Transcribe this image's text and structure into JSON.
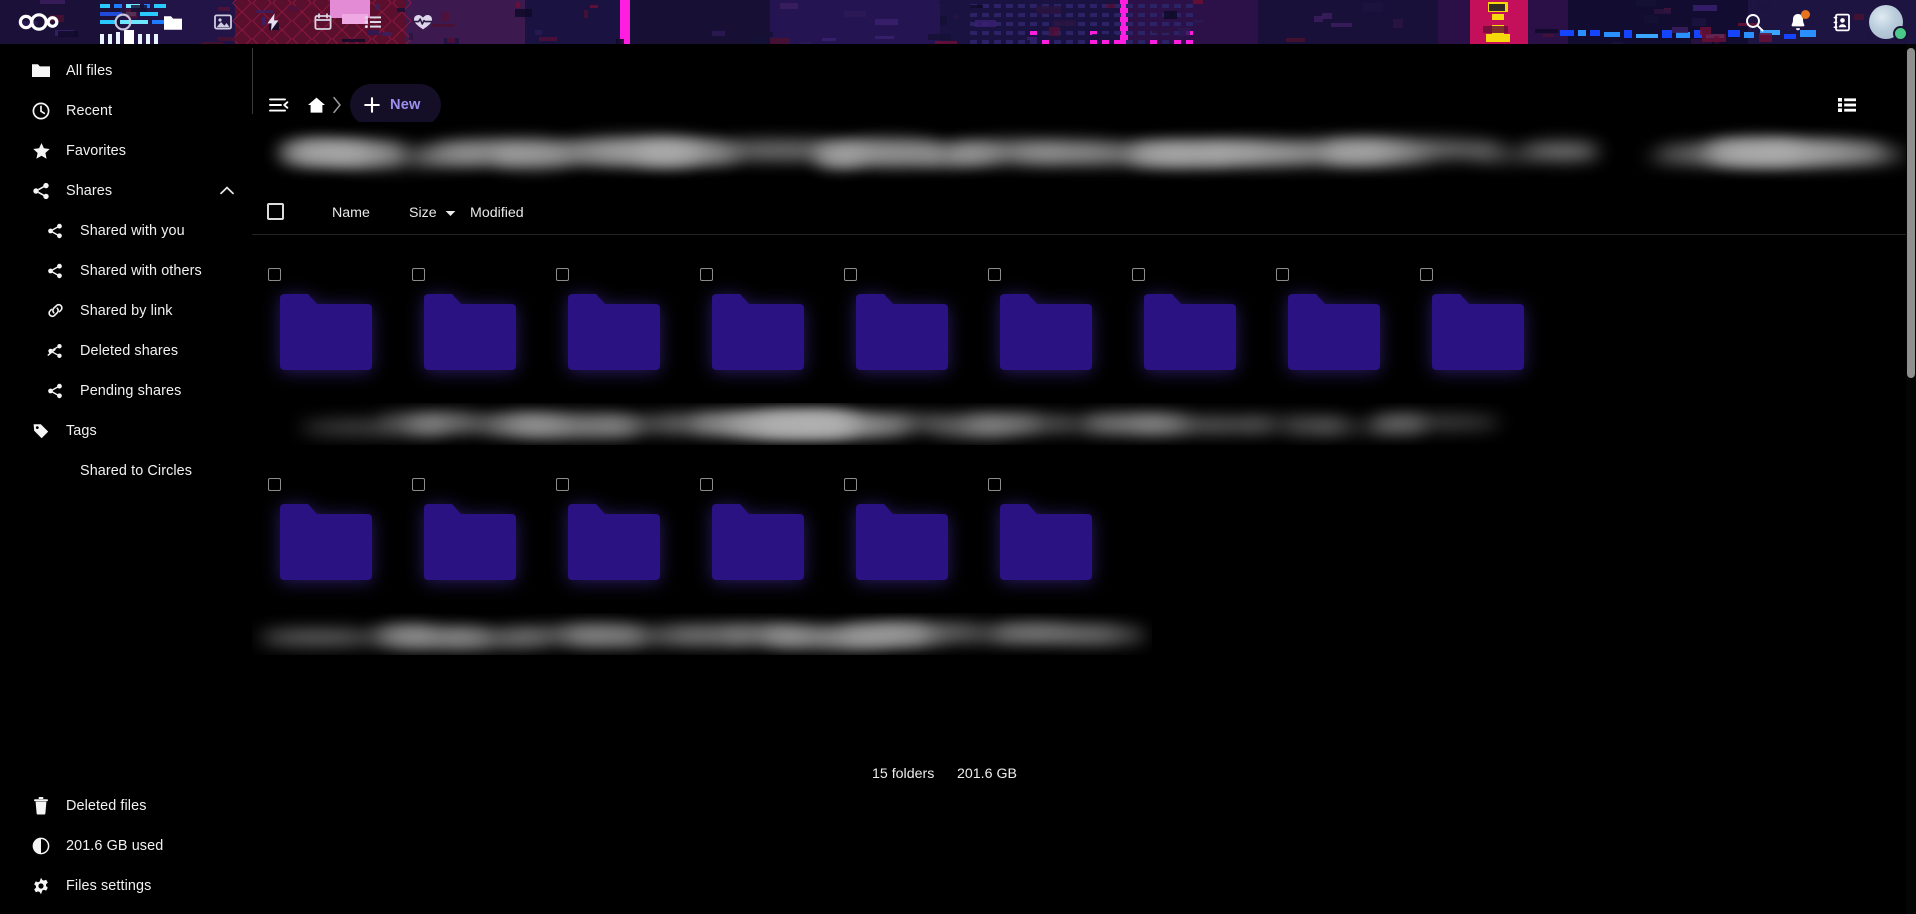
{
  "header": {
    "logo_name": "nextcloud-logo",
    "background_color": "#1b1235",
    "accent_magenta": "#ff1ee0",
    "app_icons": [
      {
        "name": "dashboard-icon",
        "label": "Dashboard",
        "active": false
      },
      {
        "name": "files-icon",
        "label": "Files",
        "active": true
      },
      {
        "name": "photos-icon",
        "label": "Photos",
        "active": false
      },
      {
        "name": "activity-icon",
        "label": "Activity",
        "active": false
      },
      {
        "name": "calendar-icon",
        "label": "Calendar",
        "active": false
      },
      {
        "name": "tasks-icon",
        "label": "Tasks",
        "active": false
      },
      {
        "name": "health-icon",
        "label": "Health",
        "active": false
      }
    ],
    "right_actions": [
      {
        "name": "search-icon",
        "label": "Search"
      },
      {
        "name": "notifications-bell-icon",
        "label": "Notifications",
        "badge": true,
        "badge_color": "#e8731d"
      },
      {
        "name": "contacts-icon",
        "label": "Contacts"
      }
    ],
    "avatar": {
      "label": "User avatar",
      "status": "online",
      "status_color": "#4ac98b"
    }
  },
  "sidebar": {
    "background_color": "#000000",
    "items": [
      {
        "label": "All files",
        "icon": "folder-icon",
        "level": 0,
        "active": false
      },
      {
        "label": "Recent",
        "icon": "clock-icon",
        "level": 0,
        "active": false
      },
      {
        "label": "Favorites",
        "icon": "star-icon",
        "level": 0,
        "active": false
      },
      {
        "label": "Shares",
        "icon": "share-icon",
        "level": 0,
        "active": false,
        "expanded": true,
        "collapse_icon": "chevron-up-icon"
      },
      {
        "label": "Shared with you",
        "icon": "share-icon",
        "level": 1,
        "active": false
      },
      {
        "label": "Shared with others",
        "icon": "share-icon",
        "level": 1,
        "active": false
      },
      {
        "label": "Shared by link",
        "icon": "link-icon",
        "level": 1,
        "active": false
      },
      {
        "label": "Deleted shares",
        "icon": "share-off-icon",
        "level": 1,
        "active": false
      },
      {
        "label": "Pending shares",
        "icon": "share-icon",
        "level": 1,
        "active": false
      },
      {
        "label": "Tags",
        "icon": "tag-icon",
        "level": 0,
        "active": false
      },
      {
        "label": "Shared to Circles",
        "icon": "circles-icon",
        "level": 1,
        "active": false,
        "no_icon": true
      }
    ],
    "bottom_items": [
      {
        "label": "Deleted files",
        "icon": "trash-icon"
      },
      {
        "label": "201.6 GB used",
        "icon": "pie-chart-icon"
      },
      {
        "label": "Files settings",
        "icon": "gear-icon"
      }
    ]
  },
  "toolbar": {
    "sidebar_toggle_icon": "sidebar-collapse-icon",
    "home_icon": "home-icon",
    "breadcrumb_separator_icon": "chevron-right-icon",
    "new_label": "New",
    "new_plus_icon": "plus-icon",
    "new_text_color": "#9d8ff0",
    "view_toggle_icon": "list-view-icon"
  },
  "file_table": {
    "select_all_label": "",
    "columns": [
      {
        "label": "Name",
        "sortable": true
      },
      {
        "label": "Size",
        "sortable": true,
        "sorted": true,
        "sort_icon": "caret-down-icon"
      },
      {
        "label": "Modified",
        "sortable": true
      }
    ],
    "folder_color": "#2b1283",
    "rows": [
      {
        "tiles": 9,
        "redacted_names": true
      },
      {
        "tiles": 6,
        "redacted_names": true
      }
    ]
  },
  "summary": {
    "folder_count": "15 folders",
    "total_size": "201.6 GB"
  },
  "scrollbar": {
    "name": "vertical-scrollbar"
  }
}
